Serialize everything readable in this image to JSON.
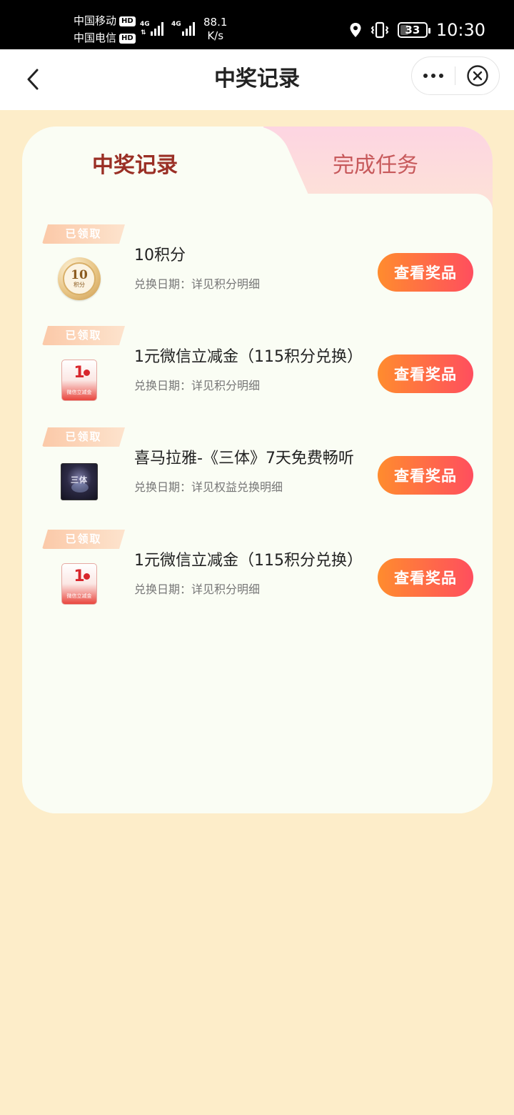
{
  "status_bar": {
    "carrier1": "中国移动",
    "carrier2": "中国电信",
    "hd_label": "HD",
    "network_label": "4G",
    "speed_value": "88.1",
    "speed_unit": "K/s",
    "battery": "33",
    "time": "10:30"
  },
  "nav": {
    "title": "中奖记录",
    "back_icon": "chevron-left-icon",
    "more_icon": "more-dots-icon",
    "close_icon": "close-circle-icon"
  },
  "tabs": [
    {
      "label": "中奖记录",
      "active": true
    },
    {
      "label": "完成任务",
      "active": false
    }
  ],
  "records": [
    {
      "status": "已领取",
      "title": "10积分",
      "subtitle": "兑换日期：详见积分明细",
      "button": "查看奖品",
      "thumb": "coin-icon",
      "coin_number": "10",
      "coin_label": "积分"
    },
    {
      "status": "已领取",
      "title": "1元微信立减金（115积分兑换）",
      "subtitle": "兑换日期：详见积分明细",
      "button": "查看奖品",
      "thumb": "red-envelope-icon",
      "env_number": "1",
      "env_label": "微信立减金"
    },
    {
      "status": "已领取",
      "title": "喜马拉雅-《三体》7天免费畅听",
      "subtitle": "兑换日期：详见权益兑换明细",
      "button": "查看奖品",
      "thumb": "book-cover-icon",
      "book_title": "三体"
    },
    {
      "status": "已领取",
      "title": "1元微信立减金（115积分兑换）",
      "subtitle": "兑换日期：详见积分明细",
      "button": "查看奖品",
      "thumb": "red-envelope-icon",
      "env_number": "1",
      "env_label": "微信立减金"
    }
  ],
  "colors": {
    "page_bg": "#fdedc9",
    "active_tab": "#9a2f25",
    "inactive_tab": "#c7595b",
    "button_gradient_start": "#ff8c2e",
    "button_gradient_end": "#ff4e5e"
  }
}
